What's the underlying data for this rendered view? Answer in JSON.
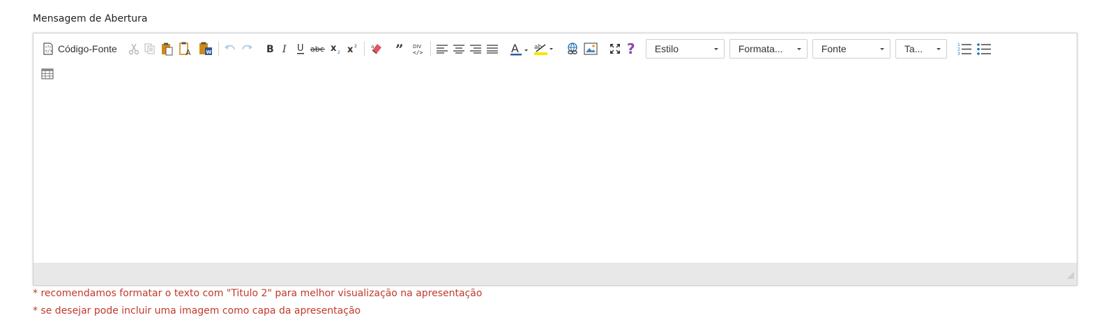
{
  "field": {
    "label": "Mensagem de Abertura"
  },
  "toolbar": {
    "source_label": "Código-Fonte",
    "styles_combo": "Estilo",
    "format_combo": "Formata...",
    "font_combo": "Fonte",
    "size_combo": "Ta...",
    "help_glyph": "?",
    "icons": [
      "source-icon",
      "cut-icon",
      "copy-icon",
      "paste-icon",
      "paste-text-icon",
      "paste-word-icon",
      "undo-icon",
      "redo-icon",
      "bold-icon",
      "italic-icon",
      "underline-icon",
      "strike-icon",
      "subscript-icon",
      "superscript-icon",
      "remove-format-icon",
      "blockquote-icon",
      "div-icon",
      "align-left-icon",
      "align-center-icon",
      "align-right-icon",
      "justify-icon",
      "text-color-icon",
      "bg-color-icon",
      "link-icon",
      "image-icon",
      "maximize-icon",
      "help-icon",
      "numbered-list-icon",
      "bulleted-list-icon",
      "table-icon"
    ],
    "colors": {
      "text_color_underline": "#2e5aa7",
      "bg_color_underline": "#f5e700",
      "help": "#8e44ad",
      "word_blue": "#2b579a",
      "paste_orange": "#d08a1a"
    }
  },
  "hints": {
    "line1": "* recomendamos formatar o texto com \"Titulo 2\" para melhor visualização na apresentação",
    "line2": "* se desejar pode incluir uma imagem como capa da apresentação"
  }
}
